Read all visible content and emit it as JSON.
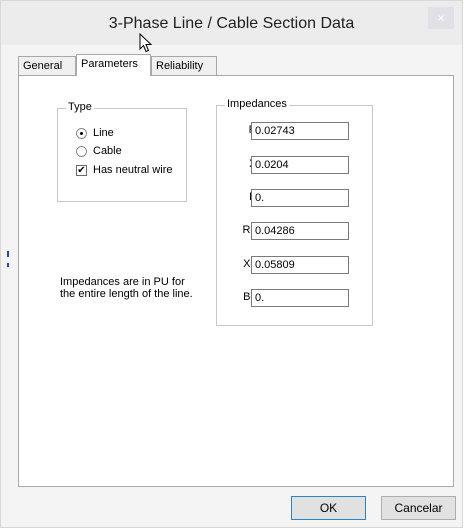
{
  "window": {
    "title": "3-Phase Line / Cable Section Data",
    "close_label": "×"
  },
  "tabs": [
    {
      "label": "General",
      "active": false
    },
    {
      "label": "Parameters",
      "active": true
    },
    {
      "label": "Reliability",
      "active": false
    }
  ],
  "type_group": {
    "title": "Type",
    "options": [
      {
        "label": "Line",
        "selected": true
      },
      {
        "label": "Cable",
        "selected": false
      }
    ],
    "neutral": {
      "label": "Has neutral wire",
      "checked": true,
      "mark": "✔"
    }
  },
  "impedances": {
    "title": "Impedances",
    "fields": [
      {
        "label": "R =",
        "value": "0.02743"
      },
      {
        "label": "X =",
        "value": "0.0204"
      },
      {
        "label": "B =",
        "value": "0."
      },
      {
        "label": "Ro =",
        "value": "0.04286"
      },
      {
        "label": "Xo =",
        "value": "0.05809"
      },
      {
        "label": "Bo =",
        "value": "0."
      }
    ]
  },
  "note": "Impedances are in PU for the entire length of the line.",
  "buttons": {
    "ok": "OK",
    "cancel": "Cancelar"
  }
}
